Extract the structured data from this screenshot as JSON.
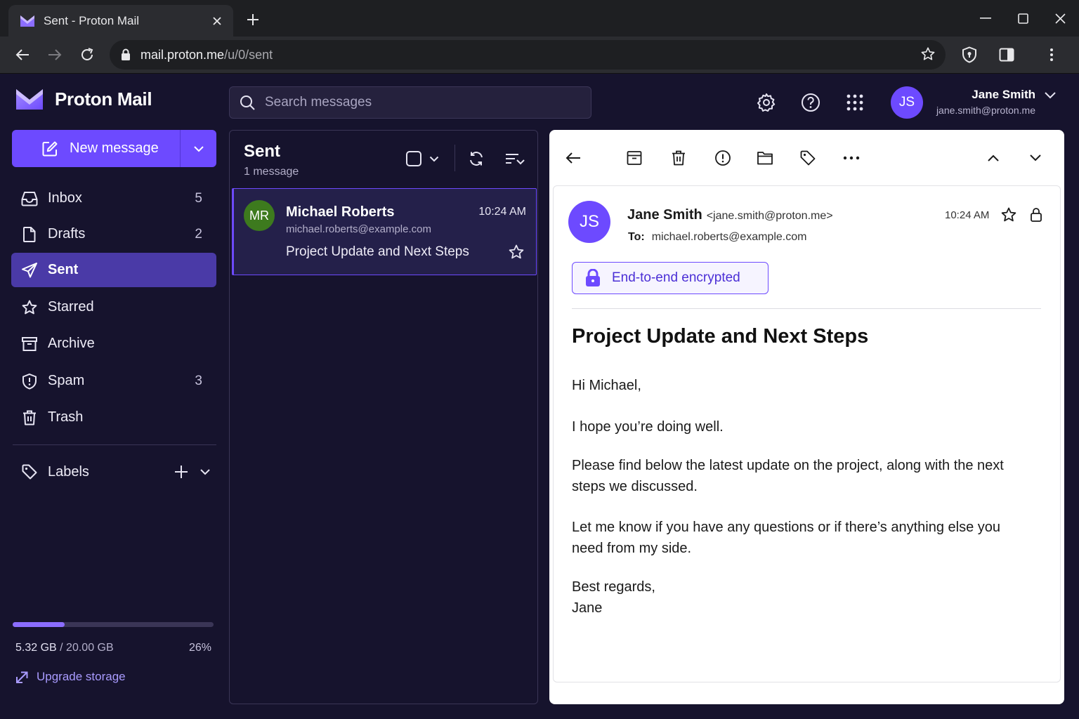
{
  "browser": {
    "tab_title": "Sent - Proton Mail",
    "url_host": "mail.proton.me",
    "url_path": "/u/0/sent"
  },
  "app": {
    "brand": "Proton Mail",
    "accent_color": "#6d4aff",
    "search_placeholder": "Search messages"
  },
  "user": {
    "initials": "JS",
    "name": "Jane Smith",
    "email": "jane.smith@proton.me"
  },
  "sidebar": {
    "new_message_label": "New message",
    "items": [
      {
        "label": "Inbox",
        "count": "5",
        "icon": "inbox-icon"
      },
      {
        "label": "Drafts",
        "count": "2",
        "icon": "file-icon"
      },
      {
        "label": "Sent",
        "count": "",
        "icon": "paper-plane-icon",
        "active": true
      },
      {
        "label": "Starred",
        "count": "",
        "icon": "star-icon"
      },
      {
        "label": "Archive",
        "count": "",
        "icon": "archive-icon"
      },
      {
        "label": "Spam",
        "count": "3",
        "icon": "shield-icon"
      },
      {
        "label": "Trash",
        "count": "",
        "icon": "trash-icon"
      }
    ],
    "labels_label": "Labels",
    "storage": {
      "used": "5.32 GB",
      "total": "/ 20.00 GB",
      "percent_label": "26%",
      "percent": 26
    },
    "upgrade_label": "Upgrade storage"
  },
  "list": {
    "title": "Sent",
    "count_label": "1 message",
    "messages": [
      {
        "initials": "MR",
        "from": "Michael Roberts",
        "email": "michael.roberts@example.com",
        "time": "10:24 AM",
        "subject": "Project Update and Next Steps"
      }
    ]
  },
  "reader": {
    "sender_initials": "JS",
    "sender_name": "Jane Smith",
    "sender_email": "<jane.smith@proton.me>",
    "time": "10:24 AM",
    "to_label": "To:",
    "to_address": "michael.roberts@example.com",
    "encryption_label": "End-to-end encrypted",
    "subject": "Project Update and Next Steps",
    "body": {
      "greeting": "Hi Michael,",
      "p1": "I hope you’re doing well.",
      "p2": "Please find below the latest update on the project, along with the next steps we discussed.",
      "p3": "Let me know if you have any questions or if there’s anything else you need from my side.",
      "signoff": "Best regards,",
      "signature": "Jane"
    }
  }
}
